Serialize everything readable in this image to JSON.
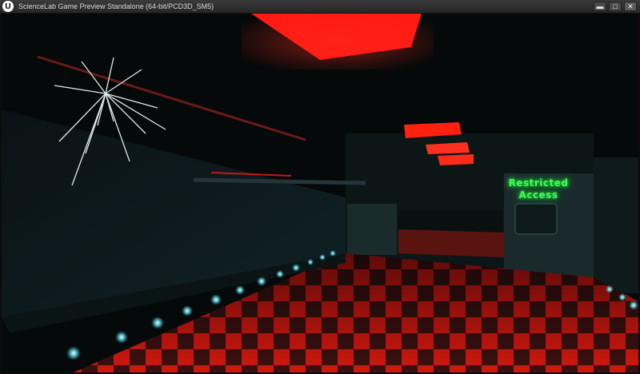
{
  "window": {
    "title": "ScienceLab Game Preview Standalone (64-bit/PCD3D_SM5)",
    "logo_letter": "U",
    "controls": {
      "minimize": "▬",
      "maximize": "□",
      "close": "✕"
    }
  },
  "scene": {
    "sign_line1": "Restricted",
    "sign_line2": "Access",
    "colors": {
      "ceiling_light": "#ff1a12",
      "floor_red": "#d01810",
      "floor_dark": "#3a1010",
      "led_cyan": "#9ff6ff",
      "sign_green": "#3cff52"
    }
  }
}
